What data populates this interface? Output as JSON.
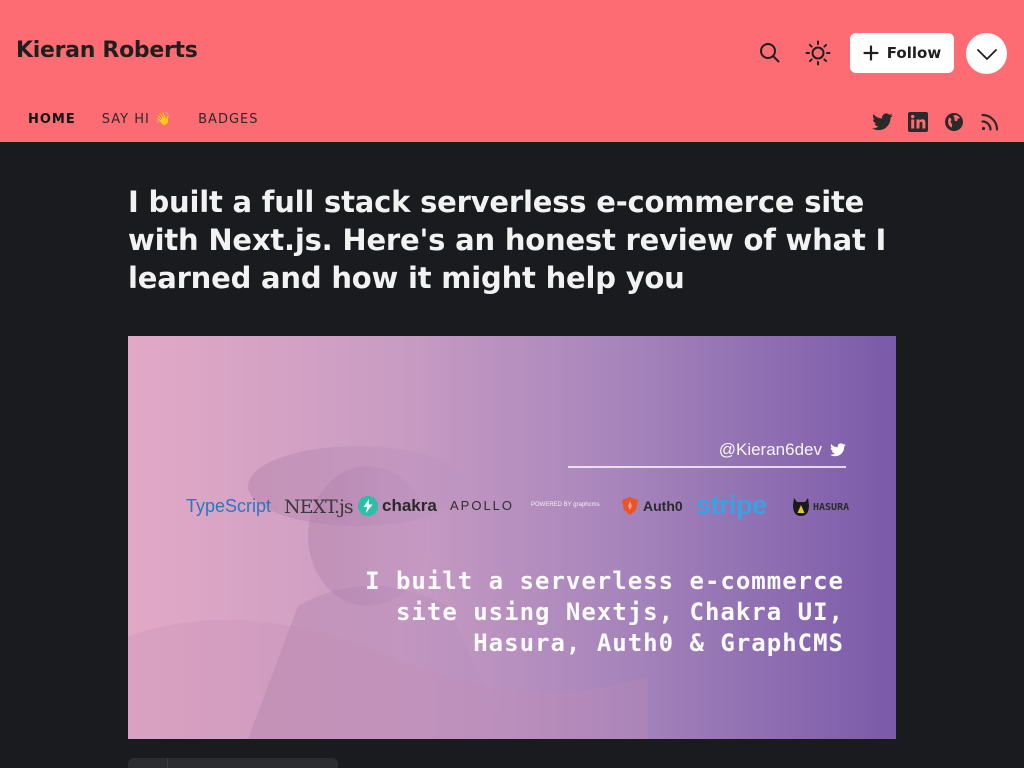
{
  "header": {
    "blog_title": "Kieran Roberts",
    "follow_label": "Follow",
    "icons": [
      "search-icon",
      "sun-icon",
      "plus-icon",
      "chevron-down-icon"
    ]
  },
  "nav": {
    "items": [
      {
        "label": "HOME",
        "active": true
      },
      {
        "label": "SAY HI 👋",
        "active": false
      },
      {
        "label": "BADGES",
        "active": false
      }
    ],
    "social_icons": [
      "twitter-icon",
      "linkedin-icon",
      "globe-icon",
      "rss-icon"
    ]
  },
  "post": {
    "title": "I built a full stack serverless e-commerce site with Next.js. Here's an honest review of what I learned and how it might help you",
    "cover": {
      "handle": "@Kieran6dev",
      "logos": [
        "TypeScript",
        "NEXT.js",
        "chakra",
        "APOLLO",
        "POWERED BY graphcms",
        "Auth0",
        "stripe",
        "HASURA"
      ],
      "caption_lines": [
        "I built a serverless e-commerce",
        "site using Nextjs, Chakra UI,",
        "Hasura, Auth0 & GraphCMS"
      ]
    }
  },
  "colors": {
    "header_bg": "#fe6c73",
    "page_bg": "#1a1b1e",
    "title_text": "#f2f2f2"
  }
}
